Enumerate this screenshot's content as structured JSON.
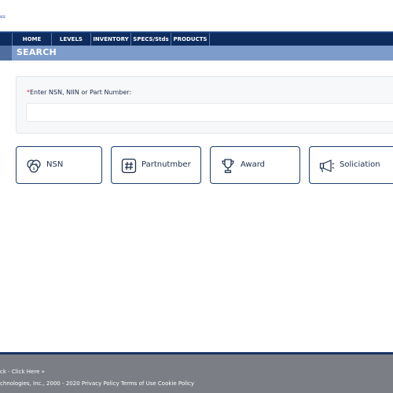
{
  "header": {
    "logo_text": "es"
  },
  "nav": {
    "items": [
      {
        "label": "HOME"
      },
      {
        "label": "LEVELS"
      },
      {
        "label": "INVENTORY"
      },
      {
        "label": "SPECS/Stds"
      },
      {
        "label": "PRODUCTS"
      }
    ]
  },
  "search_band": {
    "title": "SEARCH"
  },
  "form": {
    "label_required_mark": "*",
    "label": "Enter NSN, NIIN or Part Number:",
    "input_value": "",
    "input_placeholder": ""
  },
  "tiles": [
    {
      "label": "NSN",
      "icon": "coins-icon"
    },
    {
      "label": "Partnutmber",
      "icon": "hash-icon"
    },
    {
      "label": "Award",
      "icon": "trophy-icon"
    },
    {
      "label": "Soliciation",
      "icon": "megaphone-icon"
    }
  ],
  "footer": {
    "link_text": "ck - Click Here »",
    "copyright": "chnologies, Inc., 2000 - 2020 Privacy Policy Terms of Use Cookie Policy"
  },
  "colors": {
    "nav_bg": "#0e2d5e",
    "search_band": "#7d9ccb",
    "tile_border": "#1d3e72",
    "footer_bg": "#7b7f85",
    "required": "#d32f2f"
  }
}
